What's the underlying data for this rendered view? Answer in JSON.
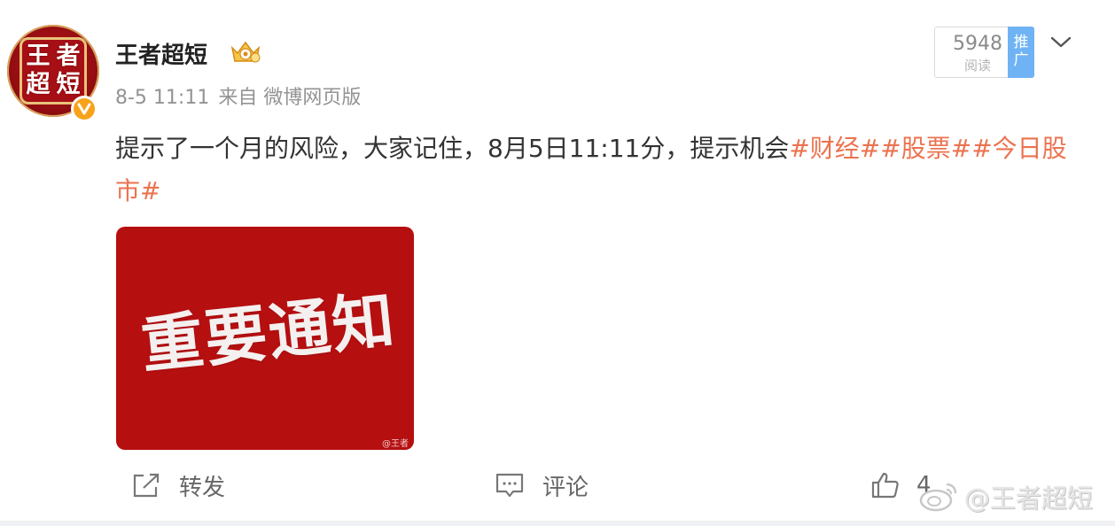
{
  "author": {
    "name": "王者超短",
    "avatar_text": [
      "王",
      "者",
      "超",
      "短"
    ]
  },
  "meta": {
    "time": "8-5 11:11",
    "source": "来自 微博网页版"
  },
  "stats": {
    "reads": "5948",
    "reads_label": "阅读",
    "promote": "推广"
  },
  "post": {
    "text": "提示了一个月的风险，大家记住，8月5日11:11分，提示机会",
    "hashtags": [
      "#财经#",
      "#股票#",
      "#今日股市#"
    ],
    "image_text": "重要通知",
    "image_watermark": "@王者"
  },
  "actions": {
    "repost": "转发",
    "comment": "评论",
    "like_count": "4"
  },
  "watermark": "@王者超短",
  "colors": {
    "hashtag": "#eb7350",
    "verified": "#f7a21b",
    "promote": "#6fb3f4",
    "image_bg": "#b50f10"
  }
}
